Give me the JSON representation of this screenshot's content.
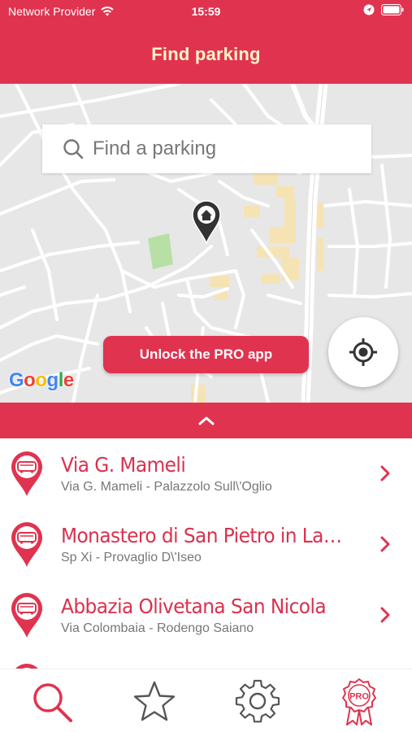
{
  "status_bar": {
    "carrier": "Network Provider",
    "time": "15:59"
  },
  "header": {
    "title": "Find parking"
  },
  "map": {
    "search_placeholder": "Find a parking",
    "pro_button_label": "Unlock the PRO app",
    "google_logo": "Google"
  },
  "parkings": [
    {
      "name": "Via G. Mameli",
      "address": "Via G. Mameli - Palazzolo Sull\\'Oglio"
    },
    {
      "name": "Monastero di San Pietro in Lamosa",
      "address": "Sp Xi - Provaglio D\\'Iseo"
    },
    {
      "name": "Abbazia Olivetana San Nicola",
      "address": "Via Colombaia - Rodengo Saiano"
    }
  ],
  "tabbar": {
    "tabs": [
      {
        "name": "search",
        "icon": "search-icon",
        "active": true
      },
      {
        "name": "favorites",
        "icon": "star-icon",
        "active": false
      },
      {
        "name": "settings",
        "icon": "gear-icon",
        "active": false
      },
      {
        "name": "pro",
        "icon": "pro-badge-icon",
        "label": "PRO",
        "active": false
      }
    ]
  },
  "colors": {
    "brand": "#e0334f",
    "title_text": "#fff6c8",
    "secondary_text": "#777777",
    "map_background": "#e7e7e7"
  }
}
